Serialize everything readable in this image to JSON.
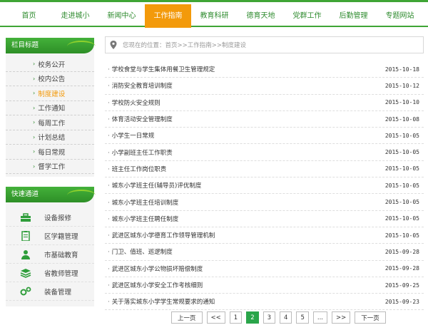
{
  "nav": {
    "items": [
      "首页",
      "走进城小",
      "新闻中心",
      "工作指南",
      "教育科研",
      "德育天地",
      "党群工作",
      "后勤管理",
      "专题网站"
    ],
    "active_index": 3
  },
  "sidebar": {
    "title": "栏目标题",
    "items": [
      "校务公开",
      "校内公告",
      "制度建设",
      "工作通知",
      "每周工作",
      "计划总结",
      "每日常规",
      "督学工作"
    ],
    "current_index": 2
  },
  "quick": {
    "title": "快速通道",
    "items": [
      {
        "label": "设备报修",
        "icon": "toolbox-icon"
      },
      {
        "label": "区学籍管理",
        "icon": "clipboard-icon"
      },
      {
        "label": "市基础教育",
        "icon": "person-icon"
      },
      {
        "label": "省教师管理",
        "icon": "layers-icon"
      },
      {
        "label": "装备管理",
        "icon": "gears-icon"
      }
    ]
  },
  "breadcrumb": {
    "text": "您现在的位置：首页>>工作指南>>制度建设"
  },
  "articles": [
    {
      "title": "学校食堂与学生集体用餐卫生管理规定",
      "date": "2015-10-18"
    },
    {
      "title": "消防安全教育培训制度",
      "date": "2015-10-12"
    },
    {
      "title": "学校防火安全规则",
      "date": "2015-10-10"
    },
    {
      "title": "体育活动安全管理制度",
      "date": "2015-10-08"
    },
    {
      "title": "小学生一日常规",
      "date": "2015-10-05"
    },
    {
      "title": "小学副班主任工作职责",
      "date": "2015-10-05"
    },
    {
      "title": "班主任工作岗位职责",
      "date": "2015-10-05"
    },
    {
      "title": "城东小学班主任(辅导员)评优制度",
      "date": "2015-10-05"
    },
    {
      "title": "城东小学班主任培训制度",
      "date": "2015-10-05"
    },
    {
      "title": "城东小学班主任聘任制度",
      "date": "2015-10-05"
    },
    {
      "title": "武进区城东小学德育工作领导管理机制",
      "date": "2015-10-05"
    },
    {
      "title": "门卫、值班、巡逻制度",
      "date": "2015-09-28"
    },
    {
      "title": "武进区城东小学公物损坏赔偿制度",
      "date": "2015-09-28"
    },
    {
      "title": "武进区城东小学安全工作考核细则",
      "date": "2015-09-25"
    },
    {
      "title": "关于落实城东小学学生常规要求的通知",
      "date": "2015-09-23"
    }
  ],
  "pager": {
    "prev": "上一页",
    "first": "<<",
    "pages": [
      "1",
      "2",
      "3",
      "4",
      "5"
    ],
    "current": "2",
    "ellipsis": "...",
    "last": ">>",
    "next": "下一页"
  },
  "colors": {
    "brand_green": "#3fa535",
    "active_orange": "#f39a0b",
    "pager_active": "#2aa54a"
  }
}
